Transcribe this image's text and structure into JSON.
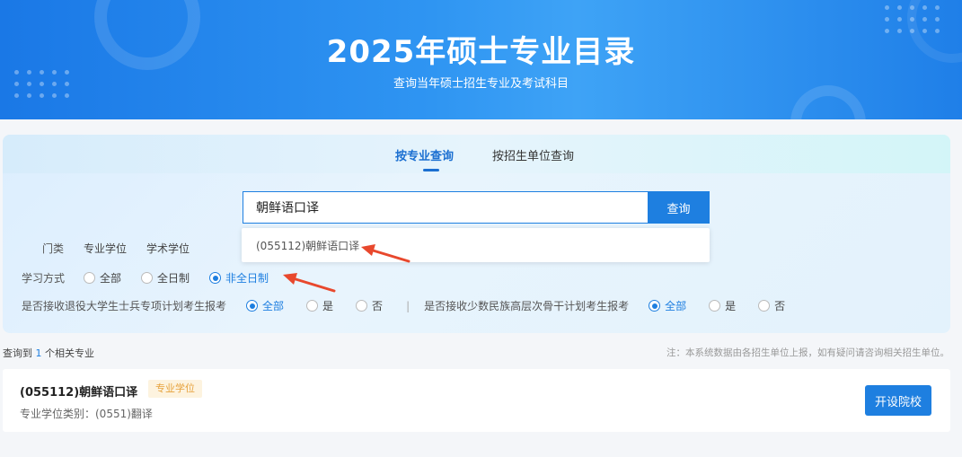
{
  "banner": {
    "title": "2025年硕士专业目录",
    "subtitle": "查询当年硕士招生专业及考试科目"
  },
  "tabs": [
    {
      "label": "按专业查询",
      "active": true
    },
    {
      "label": "按招生单位查询",
      "active": false
    }
  ],
  "search": {
    "value": "朝鲜语口译",
    "button_label": "查询",
    "suggestion": "(055112)朝鲜语口译"
  },
  "filters": {
    "category": {
      "label": "门类",
      "options": [
        "专业学位",
        "学术学位"
      ]
    },
    "study_mode": {
      "label": "学习方式",
      "options": [
        "全部",
        "全日制",
        "非全日制"
      ],
      "selected": "非全日制"
    },
    "veteran_plan": {
      "label": "是否接收退役大学生士兵专项计划考生报考",
      "options": [
        "全部",
        "是",
        "否"
      ],
      "selected": "全部"
    },
    "separator": "|",
    "minority_plan": {
      "label": "是否接收少数民族高层次骨干计划考生报考",
      "options": [
        "全部",
        "是",
        "否"
      ],
      "selected": "全部"
    }
  },
  "results": {
    "count_prefix": "查询到",
    "count": "1",
    "count_suffix": "个相关专业",
    "note": "注：本系统数据由各招生单位上报，如有疑问请咨询相关招生单位。",
    "items": [
      {
        "title": "(055112)朝鲜语口译",
        "tag": "专业学位",
        "category": "专业学位类别：(0551)翻译",
        "action_label": "开设院校"
      }
    ]
  },
  "colors": {
    "accent": "#1e7fe0",
    "annotation_arrow": "#e8482d",
    "tag_text": "#e6a23c"
  }
}
